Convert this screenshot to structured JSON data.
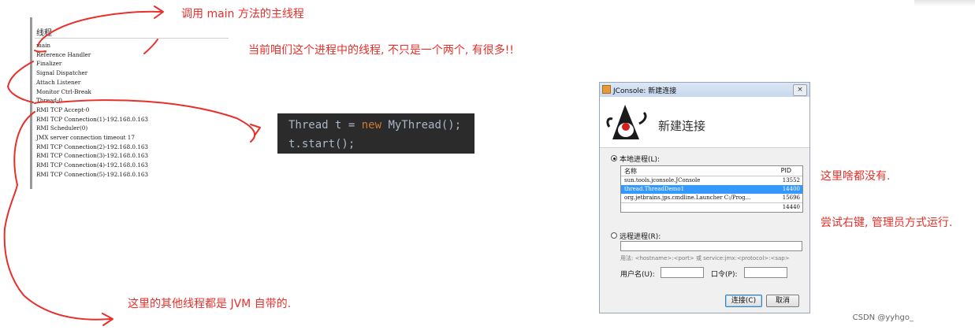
{
  "thread_panel": {
    "header": "线程",
    "threads": [
      "main",
      "Reference Handler",
      "Finalizer",
      "Signal Dispatcher",
      "Attach Listener",
      "Monitor Ctrl-Break",
      "Thread-0",
      "RMI TCP Accept-0",
      "RMI TCP Connection(1)-192.168.0.163",
      "RMI Scheduler(0)",
      "JMX server connection timeout 17",
      "RMI TCP Connection(2)-192.168.0.163",
      "RMI TCP Connection(3)-192.168.0.163",
      "RMI TCP Connection(4)-192.168.0.163",
      "RMI TCP Connection(5)-192.168.0.163"
    ]
  },
  "annotations": {
    "main_thread": "调用 main 方法的主线程",
    "many_threads": "当前咱们这个进程中的线程, 不只是一个两个, 有很多!!",
    "jvm_threads": "这里的其他线程都是 JVM 自带的.",
    "nothing_here": "这里啥都没有.",
    "run_as_admin": "尝试右键, 管理员方式运行."
  },
  "code": {
    "line1_type": "Thread t = ",
    "line1_kw": "new",
    "line1_rest": " MyThread();",
    "line2": "t.start();"
  },
  "jconsole": {
    "title": "JConsole: 新建连接",
    "close": "×",
    "heading": "新建连接",
    "local_label": "本地进程(L):",
    "col_name": "名称",
    "col_pid": "PID",
    "processes": [
      {
        "name": "sun.tools.jconsole.JConsole",
        "pid": "13552",
        "selected": false
      },
      {
        "name": "thread.ThreadDemo1",
        "pid": "14400",
        "selected": true
      },
      {
        "name": "org.jetbrains.jps.cmdline.Launcher C:/Prog...",
        "pid": "15696",
        "selected": false
      },
      {
        "name": "",
        "pid": "14440",
        "selected": false
      }
    ],
    "remote_label": "远程进程(R):",
    "usage": "用法: <hostname>:<port> 或 service:jmx:<protocol>:<sap>",
    "username_label": "用户名(U):",
    "password_label": "口令(P):",
    "connect_button": "连接(C)",
    "cancel_button": "取消"
  },
  "watermark": "CSDN @yyhgo_",
  "colors": {
    "annotation": "#e8302b",
    "selection": "#3399ff",
    "code_bg": "#2b2b2b",
    "keyword": "#cc7832"
  }
}
